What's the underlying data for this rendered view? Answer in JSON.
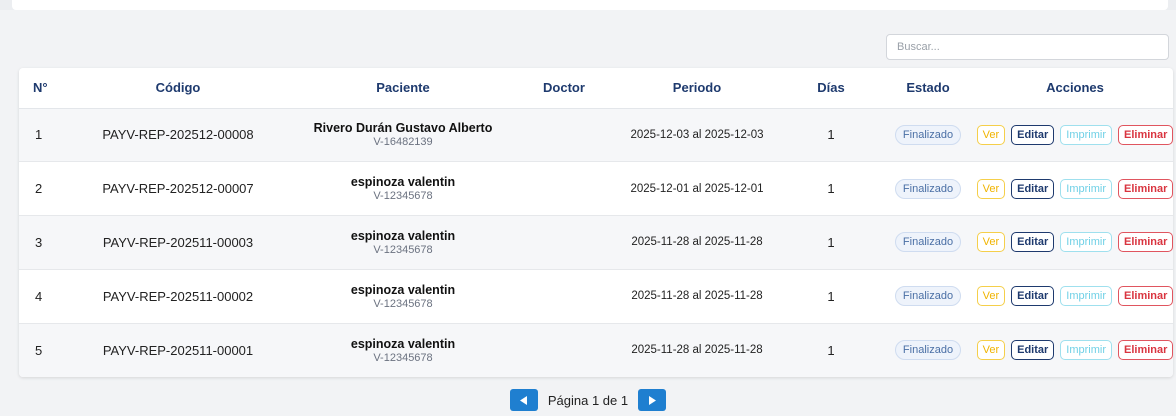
{
  "search": {
    "placeholder": "Buscar..."
  },
  "table": {
    "headers": [
      "N°",
      "Código",
      "Paciente",
      "Doctor",
      "Periodo",
      "Días",
      "Estado",
      "Acciones"
    ],
    "rows": [
      {
        "n": "1",
        "code": "PAYV-REP-202512-00008",
        "patient_name": "Rivero Durán Gustavo Alberto",
        "patient_id": "V-16482139",
        "doctor": "",
        "period": "2025-12-03 al 2025-12-03",
        "days": "1",
        "status": "Finalizado"
      },
      {
        "n": "2",
        "code": "PAYV-REP-202512-00007",
        "patient_name": "espinoza valentin",
        "patient_id": "V-12345678",
        "doctor": "",
        "period": "2025-12-01 al 2025-12-01",
        "days": "1",
        "status": "Finalizado"
      },
      {
        "n": "3",
        "code": "PAYV-REP-202511-00003",
        "patient_name": "espinoza valentin",
        "patient_id": "V-12345678",
        "doctor": "",
        "period": "2025-11-28 al 2025-11-28",
        "days": "1",
        "status": "Finalizado"
      },
      {
        "n": "4",
        "code": "PAYV-REP-202511-00002",
        "patient_name": "espinoza valentin",
        "patient_id": "V-12345678",
        "doctor": "",
        "period": "2025-11-28 al 2025-11-28",
        "days": "1",
        "status": "Finalizado"
      },
      {
        "n": "5",
        "code": "PAYV-REP-202511-00001",
        "patient_name": "espinoza valentin",
        "patient_id": "V-12345678",
        "doctor": "",
        "period": "2025-11-28 al 2025-11-28",
        "days": "1",
        "status": "Finalizado"
      }
    ],
    "actions": {
      "view": "Ver",
      "edit": "Editar",
      "print": "Imprimir",
      "delete": "Eliminar"
    }
  },
  "pagination": {
    "text": "Página 1 de 1",
    "prev_icon": "chevron-left-icon",
    "next_icon": "chevron-right-icon"
  },
  "colors": {
    "header_text": "#1e3a6e",
    "pager_button": "#1f7fd0",
    "ver": "#f0b400",
    "editar": "#1e3a6e",
    "imprimir": "#6fd0e6",
    "eliminar": "#d9343f"
  }
}
